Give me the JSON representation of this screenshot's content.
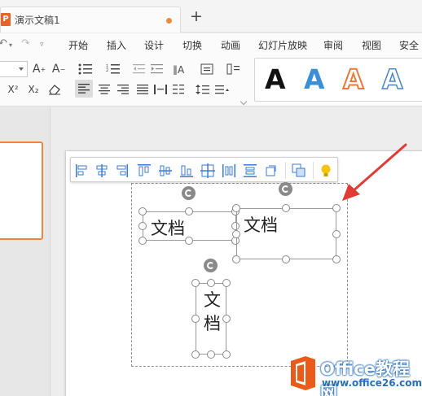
{
  "window": {
    "tab_title": "演示文稿1",
    "new_tab_label": "+"
  },
  "menu": {
    "items": [
      "开始",
      "插入",
      "设计",
      "切换",
      "动画",
      "幻灯片放映",
      "审阅",
      "视图",
      "安全"
    ]
  },
  "ribbon": {
    "text_art": {
      "sample": "A",
      "styles": [
        "black-solid",
        "blue-solid",
        "orange-outline",
        "blue-outline"
      ]
    }
  },
  "slide": {
    "textboxes": [
      {
        "name": "textbox-1",
        "text": "文档"
      },
      {
        "name": "textbox-2",
        "text": "文档"
      },
      {
        "name": "textbox-3",
        "line1": "文",
        "line2": "档"
      }
    ]
  },
  "watermark": {
    "brand": "Office教程网",
    "url": "www.office26.com"
  },
  "colors": {
    "accent_orange": "#f0843b",
    "arrow_red": "#e03c35",
    "brand_blue": "#2a6fb5"
  }
}
